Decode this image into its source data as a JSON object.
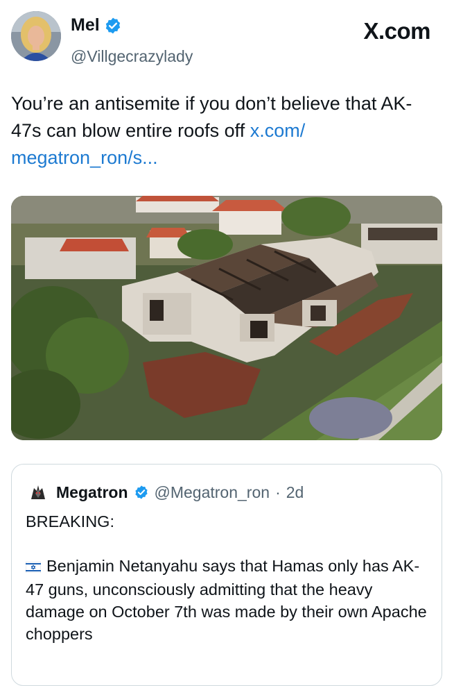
{
  "author": {
    "display_name": "Mel",
    "handle": "@Villgecrazylady",
    "avatar_icon": "profile-photo",
    "verified_color": "#1d9bf0"
  },
  "watermark": {
    "text": "X.com"
  },
  "tweet": {
    "text": "You’re an antisemite if you don’t believe that AK-47s can blow entire roofs off",
    "link_line1": "x.com/",
    "link_line2": "megatron_ron/s...",
    "link_color": "#1d7ad1"
  },
  "media": {
    "icon": "photo-aerial-burned-houses"
  },
  "quoted_tweet": {
    "display_name": "Megatron",
    "handle": "@Megatron_ron",
    "separator": "·",
    "time": "2d",
    "heading": "BREAKING:",
    "body": "Benjamin Netanyahu says that Hamas only has AK-47 guns, unconsciously admitting that the heavy damage on October 7th was made by their own Apache choppers",
    "flag_icon": "israel-flag-icon"
  }
}
